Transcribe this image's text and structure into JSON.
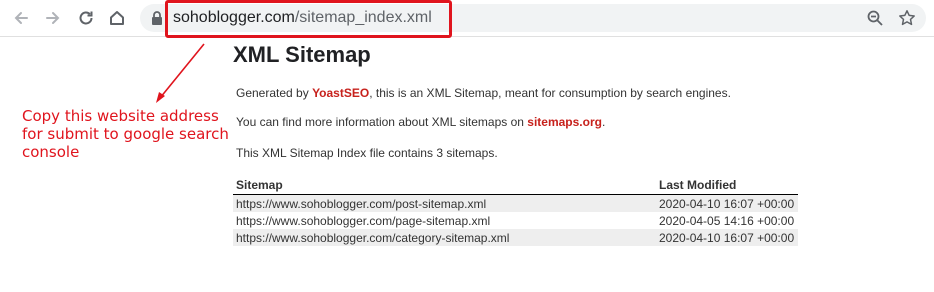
{
  "browser": {
    "url_host": "sohoblogger.com",
    "url_path": "/sitemap_index.xml"
  },
  "annotation": {
    "line1": "Copy this website address",
    "line2": "for submit to google search console",
    "color": "#e0141d"
  },
  "page": {
    "title": "XML Sitemap",
    "generated_prefix": "Generated by ",
    "generated_link": "YoastSEO",
    "generated_suffix": ", this is an XML Sitemap, meant for consumption by search engines.",
    "info_prefix": "You can find more information about XML sitemaps on ",
    "info_link": "sitemaps.org",
    "info_suffix": ".",
    "count_text": "This XML Sitemap Index file contains 3 sitemaps."
  },
  "table": {
    "headers": [
      "Sitemap",
      "Last Modified"
    ],
    "rows": [
      {
        "url": "https://www.sohoblogger.com/post-sitemap.xml",
        "modified": "2020-04-10 16:07 +00:00"
      },
      {
        "url": "https://www.sohoblogger.com/page-sitemap.xml",
        "modified": "2020-04-05 14:16 +00:00"
      },
      {
        "url": "https://www.sohoblogger.com/category-sitemap.xml",
        "modified": "2020-04-10 16:07 +00:00"
      }
    ]
  },
  "icons": [
    "back-arrow-icon",
    "forward-arrow-icon",
    "reload-icon",
    "home-icon",
    "lock-icon",
    "zoom-icon",
    "star-icon"
  ],
  "colors": {
    "link": "#c7211c",
    "highlight": "#e0141d",
    "row_alt": "#eeeeee"
  }
}
